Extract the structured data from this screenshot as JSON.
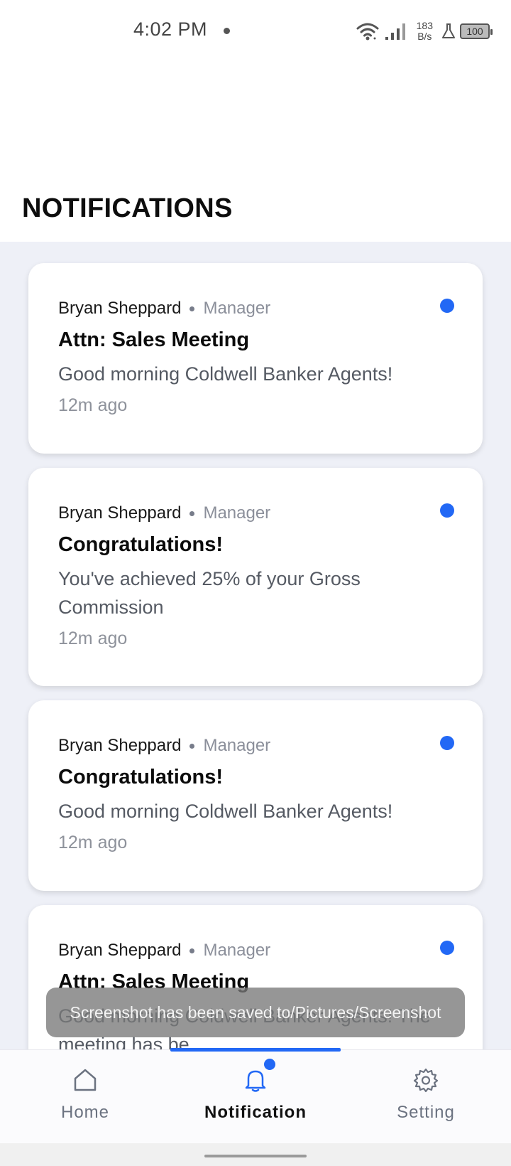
{
  "status_bar": {
    "time": "4:02 PM",
    "network_speed_value": "183",
    "network_speed_unit": "B/s",
    "battery": "100",
    "icons": [
      "wifi-icon",
      "signal-icon",
      "flask-icon",
      "battery-icon"
    ]
  },
  "page": {
    "title": "NOTIFICATIONS"
  },
  "notifications": [
    {
      "author": "Bryan Sheppard",
      "role": "Manager",
      "title": "Attn: Sales Meeting",
      "body": "Good morning Coldwell Banker Agents!",
      "time": "12m ago",
      "unread": true
    },
    {
      "author": "Bryan Sheppard",
      "role": "Manager",
      "title": "Congratulations!",
      "body": "You've achieved 25% of your Gross Commission",
      "time": "12m ago",
      "unread": true
    },
    {
      "author": "Bryan Sheppard",
      "role": "Manager",
      "title": "Congratulations!",
      "body": "Good morning Coldwell Banker Agents!",
      "time": "12m ago",
      "unread": true
    },
    {
      "author": "Bryan Sheppard",
      "role": "Manager",
      "title": "Attn: Sales Meeting",
      "body": "Good morning Coldwell Banker Agents! The meeting has be...",
      "time": "",
      "unread": true
    }
  ],
  "toast": {
    "text": "Screenshot has been saved to/Pictures/Screenshot"
  },
  "bottom_nav": {
    "items": [
      {
        "label": "Home",
        "icon": "home-icon",
        "active": false
      },
      {
        "label": "Notification",
        "icon": "bell-icon",
        "active": true
      },
      {
        "label": "Setting",
        "icon": "gear-icon",
        "active": false
      }
    ]
  },
  "colors": {
    "accent": "#2268f5",
    "feed_background": "#eef0f7"
  }
}
